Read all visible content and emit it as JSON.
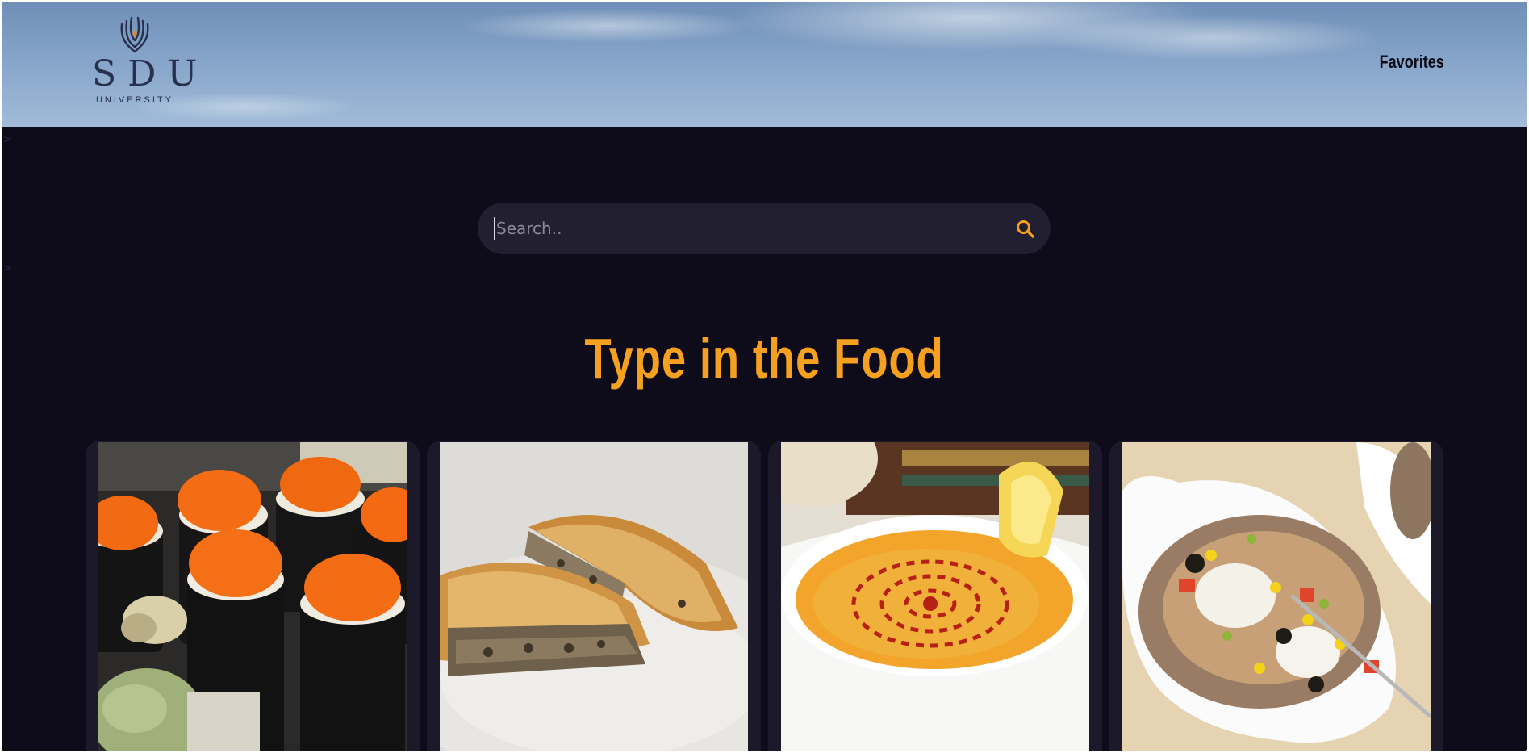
{
  "header": {
    "logo": {
      "name": "SDU",
      "subtitle": "UNIVERSITY",
      "icon": "phoenix-emblem-icon"
    },
    "nav": {
      "favorites_label": "Favorites"
    }
  },
  "search": {
    "placeholder": "Search..",
    "value": "",
    "icon": "search-icon",
    "icon_color": "#f5a11f"
  },
  "main": {
    "title": "Type in the Food"
  },
  "cards": [
    {
      "image": "sushi-rolls-with-tobiko"
    },
    {
      "image": "meat-filled-pastry-borek"
    },
    {
      "image": "lentil-soup-with-lemon"
    },
    {
      "image": "stuffed-baked-potato-kumpir"
    }
  ],
  "colors": {
    "background": "#0e0c1b",
    "accent": "#f5a11f",
    "card": "#1c1a2a",
    "search_bg": "#221f30"
  }
}
